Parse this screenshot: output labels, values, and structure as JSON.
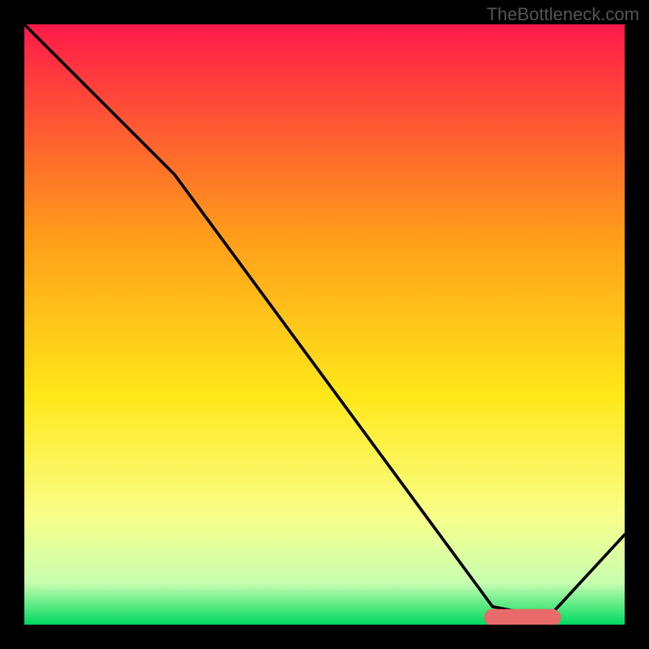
{
  "watermark": "TheBottleneck.com",
  "chart_data": {
    "type": "line",
    "title": "",
    "xlabel": "",
    "ylabel": "",
    "xlim": [
      0,
      100
    ],
    "ylim": [
      0,
      100
    ],
    "gradient_colors": {
      "top": "#ff1a4a",
      "upper_mid": "#ff9c1a",
      "mid": "#ffe81a",
      "lower_mid": "#f8ff8a",
      "near_bottom": "#c8ffb0",
      "bottom": "#00d860"
    },
    "series": [
      {
        "name": "curve",
        "color": "#000000",
        "x": [
          0,
          25,
          78,
          83,
          88,
          100
        ],
        "values": [
          100,
          75,
          3,
          2,
          2,
          15
        ]
      }
    ],
    "marker": {
      "name": "highlight-segment",
      "color": "#e86a6a",
      "x_start": 78,
      "x_end": 88,
      "y": 1.2,
      "thickness": 2.8
    }
  }
}
